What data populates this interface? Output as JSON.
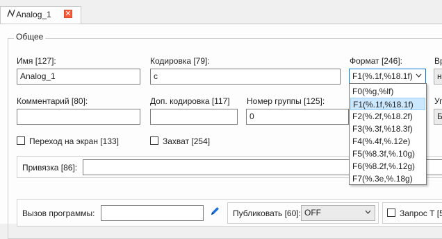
{
  "tab": {
    "icon": "waveform-icon",
    "label": "Analog_1",
    "close_icon": "close-icon"
  },
  "group": {
    "title": "Общее"
  },
  "fields": {
    "name": {
      "label": "Имя [127]:",
      "value": "Analog_1"
    },
    "encoding": {
      "label": "Кодировка [79]:",
      "value": "c"
    },
    "format": {
      "label": "Формат [246]:",
      "value": "F1(%.1f,%18.1f)"
    },
    "vr": {
      "label": "Вр",
      "value": "н"
    },
    "comment": {
      "label": "Комментарий [80]:",
      "value": ""
    },
    "extra_encoding": {
      "label": "Доп. кодировка [117]",
      "value": ""
    },
    "group_number": {
      "label": "Номер группы [125]:",
      "value": "0"
    },
    "ug": {
      "label": "Уг",
      "value": "Б"
    },
    "binding": {
      "label": "Привязка [86]:",
      "value": ""
    },
    "program_call": {
      "label": "Вызов программы:",
      "value": ""
    },
    "publish": {
      "label": "Публиковать [60]:",
      "value": "OFF"
    },
    "request": {
      "label": "Запрос Т [5"
    }
  },
  "checkboxes": {
    "go_to_screen": {
      "label": "Переход на экран [133]",
      "checked": false
    },
    "capture": {
      "label": "Захват [254]",
      "checked": false
    },
    "request_t": {
      "checked": false
    }
  },
  "format_options": [
    "F0(%g,%lf)",
    "F1(%.1f,%18.1f)",
    "F2(%.2f,%18.2f)",
    "F3(%.3f,%18.3f)",
    "F4(%.4f,%.12e)",
    "F5(%8.3f,%.10g)",
    "F6(%8.2f,%.12g)",
    "F7(%.3e,%.18g)"
  ],
  "selected_format_index": 1,
  "colors": {
    "accent": "#0078d7",
    "selection": "#cce8ff",
    "close_red": "#ff5a36",
    "pencil": "#1e6fd9"
  }
}
